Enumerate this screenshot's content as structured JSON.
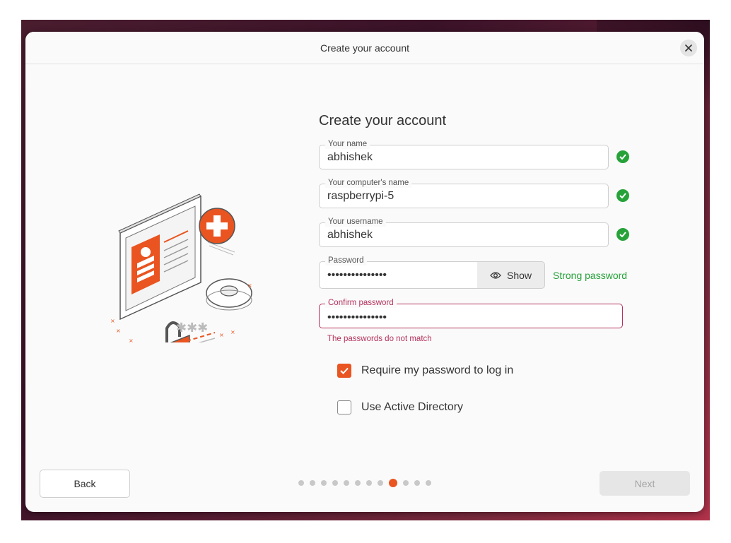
{
  "window": {
    "title": "Create your account"
  },
  "form": {
    "heading": "Create your account",
    "fields": {
      "name": {
        "label": "Your name",
        "value": "abhishek",
        "valid": true
      },
      "computer_name": {
        "label": "Your computer's name",
        "value": "raspberrypi-5",
        "valid": true
      },
      "username": {
        "label": "Your username",
        "value": "abhishek",
        "valid": true
      },
      "password": {
        "label": "Password",
        "value": "•••••••••••••••",
        "show_label": "Show",
        "strength": "Strong password"
      },
      "confirm_password": {
        "label": "Confirm password",
        "value": "•••••••••••••••",
        "error": "The passwords do not match"
      }
    },
    "options": {
      "require_password": {
        "label": "Require my password to log in",
        "checked": true
      },
      "active_directory": {
        "label": "Use Active Directory",
        "checked": false
      }
    }
  },
  "nav": {
    "back_label": "Back",
    "next_label": "Next",
    "pager": {
      "total": 12,
      "current": 9
    }
  },
  "colors": {
    "accent": "#e95420",
    "success": "#26a239",
    "error": "#b5325c"
  },
  "icons": {
    "close": "close-icon",
    "check": "checkmark-icon",
    "eye": "eye-icon"
  }
}
